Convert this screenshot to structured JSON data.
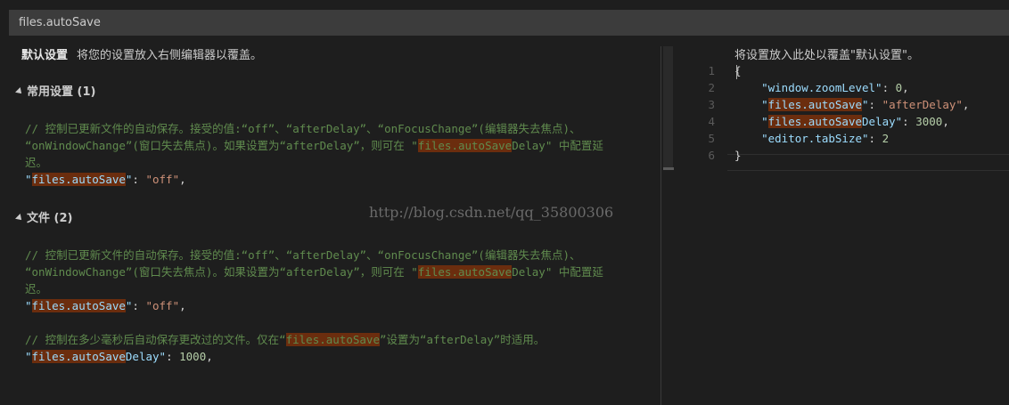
{
  "search": {
    "value": "files.autoSave"
  },
  "left": {
    "header_bold": "默认设置",
    "header_text": "将您的设置放入右侧编辑器以覆盖。",
    "sections": [
      {
        "title": "常用设置 (1)"
      },
      {
        "title": "文件 (2)"
      }
    ],
    "comment_a1": "// 控制已更新文件的自动保存。接受的值:“off”、“afterDelay”、“onFocusChange”(编辑器失去焦点)、",
    "comment_a2_pre": "“onWindowChange”(窗口失去焦点)。如果设置为“afterDelay”，则可在 \"",
    "comment_a2_hl": "files.autoSave",
    "comment_a2_post": "Delay\" 中配置延",
    "comment_a3": "迟。",
    "entry_q": "\"",
    "entry_key_hl": "files.autoSave",
    "entry_rest": "\": ",
    "entry_val": "\"off\"",
    "entry_comma": ",",
    "comment_c1_pre": "// 控制在多少毫秒后自动保存更改过的文件。仅在“",
    "comment_c1_hl": "files.autoSave",
    "comment_c1_post": "”设置为“afterDelay”时适用。",
    "entry2_key_hl": "files.autoSave",
    "entry2_key_rest": "Delay",
    "entry2_val": "1000",
    "watermark": "http://blog.csdn.net/qq_35800306"
  },
  "right": {
    "header": "将设置放入此处以覆盖\"默认设置\"。",
    "line_numbers": [
      "1",
      "2",
      "3",
      "4",
      "5",
      "6"
    ],
    "open_brace": "{",
    "close_brace": "}",
    "l2_key": "\"window.zoomLevel\"",
    "l2_val": "0",
    "l3_key_hl": "files.autoSave",
    "l3_val": "\"afterDelay\"",
    "l4_key_hl": "files.autoSave",
    "l4_key_rest": "Delay",
    "l4_val": "3000",
    "l5_key": "\"editor.tabSize\"",
    "l5_val": "2"
  }
}
